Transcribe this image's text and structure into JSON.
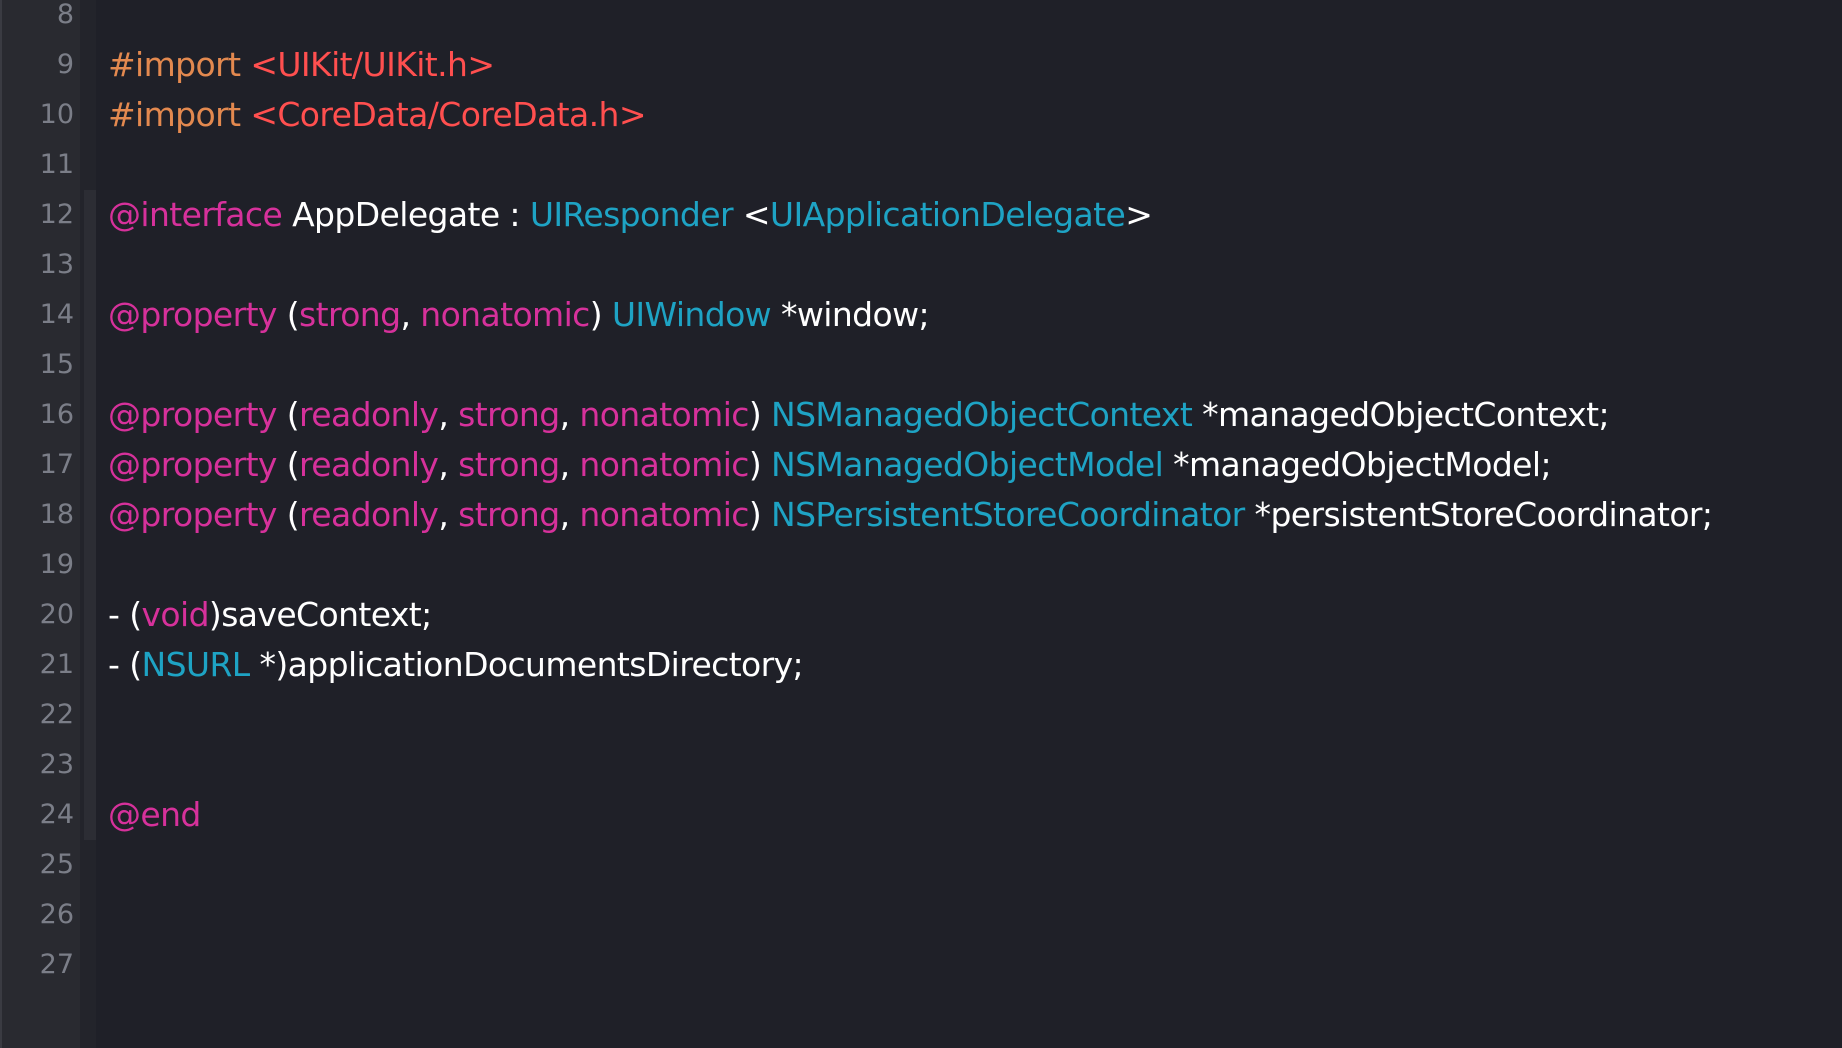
{
  "editor": {
    "lines": [
      {
        "number": "8",
        "tokens": []
      },
      {
        "number": "9",
        "tokens": [
          {
            "text": "#import ",
            "kind": "pre"
          },
          {
            "text": "<UIKit/UIKit.h>",
            "kind": "str"
          }
        ]
      },
      {
        "number": "10",
        "tokens": [
          {
            "text": "#import ",
            "kind": "pre"
          },
          {
            "text": "<CoreData/CoreData.h>",
            "kind": "str"
          }
        ]
      },
      {
        "number": "11",
        "tokens": []
      },
      {
        "number": "12",
        "tokens": [
          {
            "text": "@interface",
            "kind": "kw"
          },
          {
            "text": " AppDelegate : ",
            "kind": "plain"
          },
          {
            "text": "UIResponder",
            "kind": "type"
          },
          {
            "text": " <",
            "kind": "plain"
          },
          {
            "text": "UIApplicationDelegate",
            "kind": "type"
          },
          {
            "text": ">",
            "kind": "plain"
          }
        ]
      },
      {
        "number": "13",
        "tokens": []
      },
      {
        "number": "14",
        "tokens": [
          {
            "text": "@property",
            "kind": "kw"
          },
          {
            "text": " (",
            "kind": "plain"
          },
          {
            "text": "strong",
            "kind": "kw"
          },
          {
            "text": ", ",
            "kind": "plain"
          },
          {
            "text": "nonatomic",
            "kind": "kw"
          },
          {
            "text": ") ",
            "kind": "plain"
          },
          {
            "text": "UIWindow",
            "kind": "type"
          },
          {
            "text": " *window;",
            "kind": "plain"
          }
        ]
      },
      {
        "number": "15",
        "tokens": []
      },
      {
        "number": "16",
        "tokens": [
          {
            "text": "@property",
            "kind": "kw"
          },
          {
            "text": " (",
            "kind": "plain"
          },
          {
            "text": "readonly",
            "kind": "kw"
          },
          {
            "text": ", ",
            "kind": "plain"
          },
          {
            "text": "strong",
            "kind": "kw"
          },
          {
            "text": ", ",
            "kind": "plain"
          },
          {
            "text": "nonatomic",
            "kind": "kw"
          },
          {
            "text": ") ",
            "kind": "plain"
          },
          {
            "text": "NSManagedObjectContext",
            "kind": "type"
          },
          {
            "text": " *managedObjectContext;",
            "kind": "plain"
          }
        ]
      },
      {
        "number": "17",
        "tokens": [
          {
            "text": "@property",
            "kind": "kw"
          },
          {
            "text": " (",
            "kind": "plain"
          },
          {
            "text": "readonly",
            "kind": "kw"
          },
          {
            "text": ", ",
            "kind": "plain"
          },
          {
            "text": "strong",
            "kind": "kw"
          },
          {
            "text": ", ",
            "kind": "plain"
          },
          {
            "text": "nonatomic",
            "kind": "kw"
          },
          {
            "text": ") ",
            "kind": "plain"
          },
          {
            "text": "NSManagedObjectModel",
            "kind": "type"
          },
          {
            "text": " *managedObjectModel;",
            "kind": "plain"
          }
        ]
      },
      {
        "number": "18",
        "tokens": [
          {
            "text": "@property",
            "kind": "kw"
          },
          {
            "text": " (",
            "kind": "plain"
          },
          {
            "text": "readonly",
            "kind": "kw"
          },
          {
            "text": ", ",
            "kind": "plain"
          },
          {
            "text": "strong",
            "kind": "kw"
          },
          {
            "text": ", ",
            "kind": "plain"
          },
          {
            "text": "nonatomic",
            "kind": "kw"
          },
          {
            "text": ") ",
            "kind": "plain"
          },
          {
            "text": "NSPersistentStoreCoordinator",
            "kind": "type"
          },
          {
            "text": " *persistentStoreCoordinator;",
            "kind": "plain"
          }
        ]
      },
      {
        "number": "19",
        "tokens": []
      },
      {
        "number": "20",
        "tokens": [
          {
            "text": "- (",
            "kind": "plain"
          },
          {
            "text": "void",
            "kind": "kw"
          },
          {
            "text": ")saveContext;",
            "kind": "plain"
          }
        ]
      },
      {
        "number": "21",
        "tokens": [
          {
            "text": "- (",
            "kind": "plain"
          },
          {
            "text": "NSURL",
            "kind": "type"
          },
          {
            "text": " *)applicationDocumentsDirectory;",
            "kind": "plain"
          }
        ]
      },
      {
        "number": "22",
        "tokens": []
      },
      {
        "number": "23",
        "tokens": []
      },
      {
        "number": "24",
        "tokens": [
          {
            "text": "@end",
            "kind": "kw"
          }
        ]
      },
      {
        "number": "25",
        "tokens": []
      },
      {
        "number": "26",
        "tokens": []
      },
      {
        "number": "27",
        "tokens": []
      }
    ]
  },
  "colors": {
    "background": "#1f2028",
    "gutter": "#292a30",
    "line_number": "#7b7e88",
    "preprocessor": "#e3894f",
    "string": "#ff4f4f",
    "keyword": "#d6319b",
    "type": "#1ea3c4",
    "plain": "#ffffff"
  }
}
